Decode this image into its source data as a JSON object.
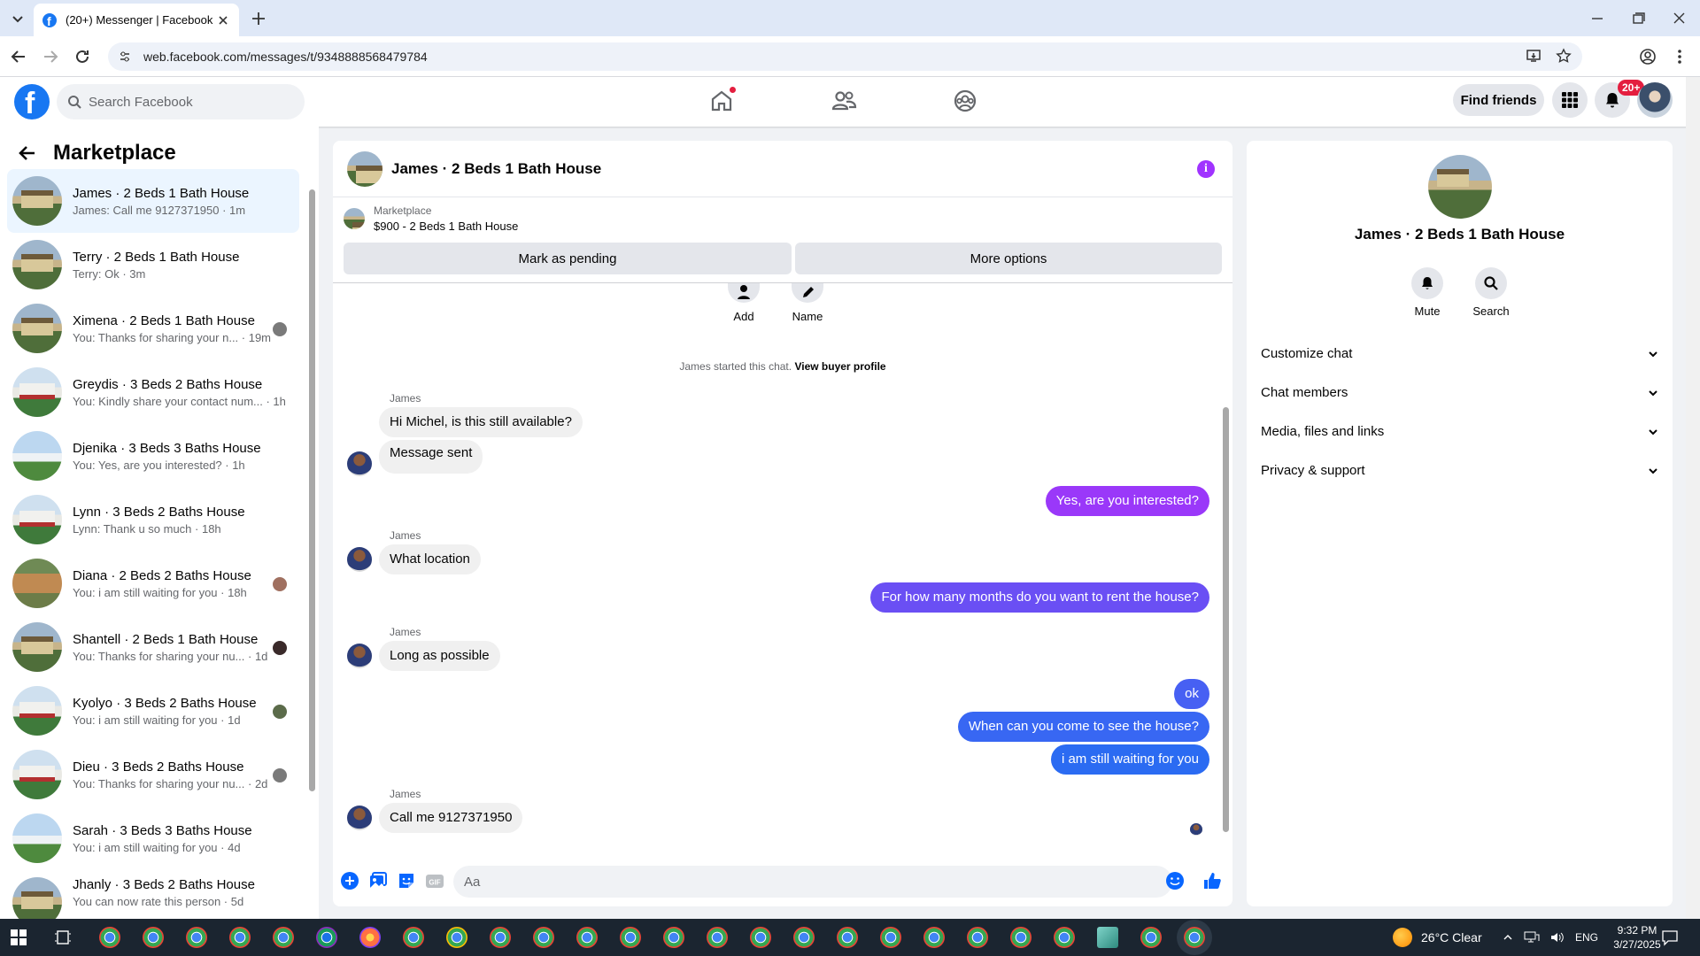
{
  "browser": {
    "tab_title": "(20+) Messenger | Facebook",
    "url": "web.facebook.com/messages/t/9348888568479784"
  },
  "header": {
    "search_placeholder": "Search Facebook",
    "find_friends": "Find friends",
    "notif_badge": "20+"
  },
  "sidebar": {
    "title": "Marketplace",
    "conversations": [
      {
        "name": "James · 2 Beds 1 Bath House",
        "preview": "James: Call me 9127371950 · 1m",
        "active": true
      },
      {
        "name": "Terry · 2 Beds 1 Bath House",
        "preview": "Terry: Ok · 3m"
      },
      {
        "name": "Ximena · 2 Beds 1 Bath House",
        "preview": "You: Thanks for sharing your n... · 19m"
      },
      {
        "name": "Greydis · 3 Beds 2 Baths House",
        "preview": "You: Kindly share your contact num... · 1h"
      },
      {
        "name": "Djenika · 3 Beds 3 Baths House",
        "preview": "You: Yes, are you interested? · 1h"
      },
      {
        "name": "Lynn · 3 Beds 2 Baths House",
        "preview": "Lynn: Thank u so much · 18h"
      },
      {
        "name": "Diana · 2 Beds 2 Baths House",
        "preview": "You: i am still waiting for you · 18h"
      },
      {
        "name": "Shantell · 2 Beds 1 Bath House",
        "preview": "You: Thanks for sharing your nu... · 1d"
      },
      {
        "name": "Kyolyo · 3 Beds 2 Baths House",
        "preview": "You: i am still waiting for you · 1d"
      },
      {
        "name": "Dieu · 3 Beds 2 Baths House",
        "preview": "You: Thanks for sharing your nu... · 2d"
      },
      {
        "name": "Sarah · 3 Beds 3 Baths House",
        "preview": "You: i am still waiting for you · 4d"
      },
      {
        "name": "Jhanly · 3 Beds 2 Baths House",
        "preview": "You can now rate this person · 5d"
      }
    ]
  },
  "chat": {
    "title": "James · 2 Beds 1 Bath House",
    "listing_label": "Marketplace",
    "listing_text": "$900 - 2 Beds 1 Bath House",
    "mark_pending": "Mark as pending",
    "more_options": "More options",
    "add_label": "Add",
    "name_label": "Name",
    "started_text": "James started this chat.",
    "view_profile": "View buyer profile",
    "messages": [
      {
        "sender": "James",
        "text": "Hi Michel, is this still available?",
        "dir": "in"
      },
      {
        "text": "Message sent",
        "dir": "in"
      },
      {
        "text": "Yes, are you interested?",
        "dir": "out"
      },
      {
        "sender": "James",
        "text": "What location",
        "dir": "in"
      },
      {
        "text": "For how many months do you want to rent the house?",
        "dir": "out"
      },
      {
        "sender": "James",
        "text": "Long as possible",
        "dir": "in"
      },
      {
        "text": "ok",
        "dir": "out"
      },
      {
        "text": "When can you come to see the house?",
        "dir": "out"
      },
      {
        "text": "i am still waiting for you",
        "dir": "out"
      },
      {
        "sender": "James",
        "text": "Call me 9127371950",
        "dir": "in"
      }
    ],
    "input_placeholder": "Aa",
    "colors": {
      "out_top": "#a033ff",
      "out_bottom": "#1d6ff2"
    }
  },
  "details": {
    "name": "James · 2 Beds 1 Bath House",
    "mute": "Mute",
    "search": "Search",
    "sections": [
      "Customize chat",
      "Chat members",
      "Media, files and links",
      "Privacy & support"
    ]
  },
  "taskbar": {
    "weather": "26°C  Clear",
    "lang": "ENG",
    "time": "9:32 PM",
    "date": "3/27/2025"
  }
}
